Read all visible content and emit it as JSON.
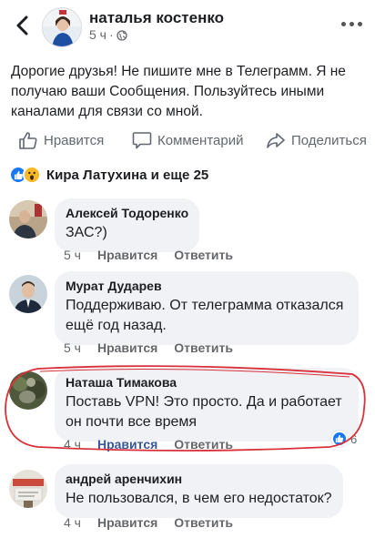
{
  "post": {
    "author": "наталья костенко",
    "time": "5 ч",
    "dot": "·",
    "text": "Дорогие друзья! Не пишите мне в Телеграмм. Я не получаю ваши Сообщения. Пользуйтесь иными каналами для связи со мной."
  },
  "actions": {
    "like": "Нравится",
    "comment": "Комментарий",
    "share": "Поделиться"
  },
  "reactions": {
    "text": "Кира Латухина и еще 25"
  },
  "comments": [
    {
      "name": "Алексей Тодоренко",
      "text": "ЗАС?)",
      "time": "5 ч",
      "like": "Нравится",
      "reply": "Ответить"
    },
    {
      "name": "Мурат Дударев",
      "text": "Поддерживаю. От телеграмма отказался ещё год назад.",
      "time": "5 ч",
      "like": "Нравится",
      "reply": "Ответить"
    },
    {
      "name": "Наташа Тимакова",
      "text": "Поставь VPN! Это просто. Да и работает он почти все время",
      "time": "4 ч",
      "like": "Нравится",
      "reply": "Ответить",
      "like_count": "6"
    },
    {
      "name": "андрей аренчихин",
      "text": "Не пользовался, в чем его недостаток?",
      "time": "4 ч",
      "like": "Нравится",
      "reply": "Ответить"
    }
  ],
  "colors": {
    "accent": "#1877f2",
    "liked_text": "#385898",
    "highlight_circle": "#d9303a",
    "bubble": "#f0f2f5"
  }
}
